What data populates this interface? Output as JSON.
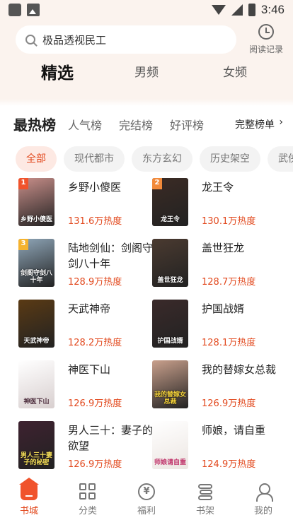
{
  "status": {
    "time": "3:46"
  },
  "search": {
    "query": "极品透视民工"
  },
  "history": {
    "label": "阅读记录"
  },
  "top_tabs": [
    "精选",
    "男频",
    "女频"
  ],
  "rank_tabs": [
    "最热榜",
    "人气榜",
    "完结榜",
    "好评榜"
  ],
  "rank_full": "完整榜单",
  "rank_chevron": "›",
  "chips": [
    "全部",
    "现代都市",
    "东方玄幻",
    "历史架空",
    "武侠"
  ],
  "books": [
    {
      "rank": "1",
      "title": "乡野小傻医",
      "heat": "131.6万热度",
      "cover_text": "乡野小傻医",
      "cover_color": "#c98f8a"
    },
    {
      "rank": "2",
      "title": "龙王令",
      "heat": "130.1万热度",
      "cover_text": "龙王令",
      "cover_color": "#3b2b24"
    },
    {
      "rank": "3",
      "title": "陆地剑仙：剑阁守剑八十年",
      "heat": "128.9万热度",
      "cover_text": "剑阁守剑八十年",
      "cover_color": "#8fa6b8"
    },
    {
      "rank": "",
      "title": "盖世狂龙",
      "heat": "128.7万热度",
      "cover_text": "盖世狂龙",
      "cover_color": "#4a3a30"
    },
    {
      "rank": "",
      "title": "天武神帝",
      "heat": "128.2万热度",
      "cover_text": "天武神帝",
      "cover_color": "#5a3a14"
    },
    {
      "rank": "",
      "title": "护国战婿",
      "heat": "128.1万热度",
      "cover_text": "护国战婿",
      "cover_color": "#3a2a2a"
    },
    {
      "rank": "",
      "title": "神医下山",
      "heat": "126.9万热度",
      "cover_text": "神医下山",
      "cover_color": "#d8cfcf"
    },
    {
      "rank": "",
      "title": "我的替嫁女总裁",
      "heat": "126.9万热度",
      "cover_text": "我的替嫁女总裁",
      "cover_color": "#c9a08c"
    },
    {
      "rank": "",
      "title": "男人三十：妻子的欲望",
      "heat": "126.9万热度",
      "cover_text": "男人三十妻子的秘密",
      "cover_color": "#3e2230"
    },
    {
      "rank": "",
      "title": "师娘，请自重",
      "heat": "124.9万热度",
      "cover_text": "师娘请自重",
      "cover_color": "#ece6e2"
    }
  ],
  "bottom_nav": [
    "书城",
    "分类",
    "福利",
    "书架",
    "我的"
  ],
  "colors": {
    "accent": "#e2491e",
    "badge_1": "#f0532c",
    "badge_2": "#f28a3a",
    "badge_3": "#f5b32f"
  },
  "icons": {
    "yen": "¥"
  }
}
